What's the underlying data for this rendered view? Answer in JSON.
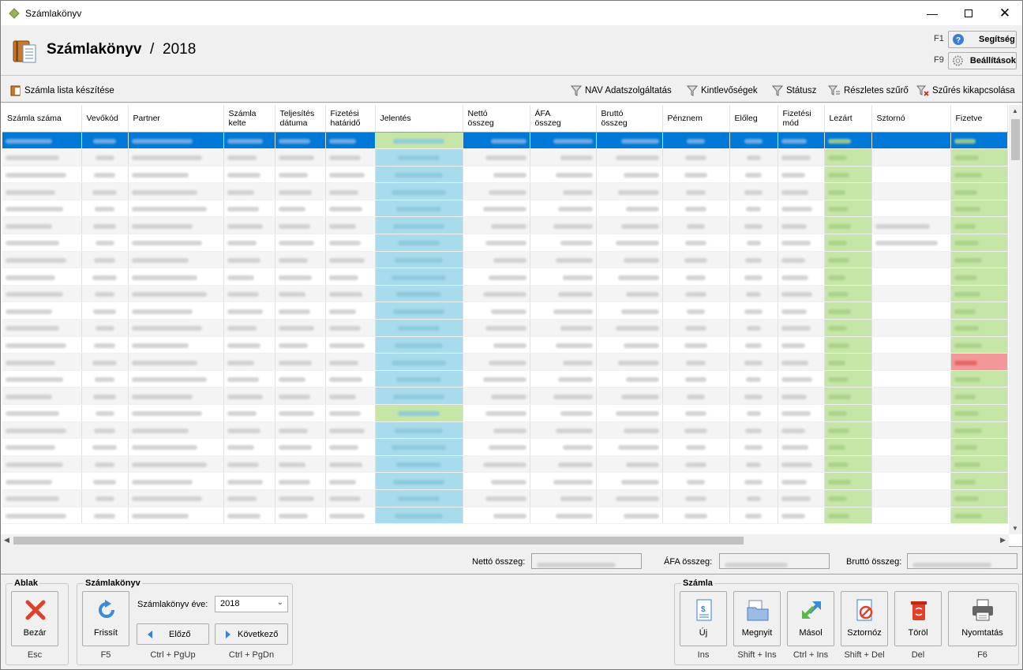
{
  "window": {
    "title": "Számlakönyv"
  },
  "header": {
    "title": "Számlakönyv",
    "separator": "/",
    "year": "2018",
    "help": {
      "key": "F1",
      "label": "Segítség"
    },
    "settings": {
      "key": "F9",
      "label": "Beállítások"
    }
  },
  "toolbar": {
    "create_list": "Számla lista készítése",
    "nav": "NAV Adatszolgáltatás",
    "receivables": "Kintlevőségek",
    "status": "Státusz",
    "detailed_filter": "Részletes szűrő",
    "filter_off": "Szűrés kikapcsolása"
  },
  "columns": [
    "Számla száma",
    "Vevőkód",
    "Partner",
    "Számla\nkelte",
    "Teljesítés\ndátuma",
    "Fizetési\nhatáridő",
    "Jelentés",
    "Nettó\nösszeg",
    "ÁFA\nösszeg",
    "Bruttó\nösszeg",
    "Pénznem",
    "Előleg",
    "Fizetési\nmód",
    "Lezárt",
    "Sztornó",
    "Fizetve"
  ],
  "rows": [
    {
      "jel": "ok",
      "fiz": "",
      "sel": true
    },
    {
      "jel": "",
      "fiz": ""
    },
    {
      "jel": "",
      "fiz": ""
    },
    {
      "jel": "",
      "fiz": ""
    },
    {
      "jel": "",
      "fiz": ""
    },
    {
      "jel": "",
      "fiz": "",
      "sz": true
    },
    {
      "jel": "",
      "fiz": "",
      "sz": true
    },
    {
      "jel": "",
      "fiz": ""
    },
    {
      "jel": "",
      "fiz": ""
    },
    {
      "jel": "",
      "fiz": ""
    },
    {
      "jel": "",
      "fiz": ""
    },
    {
      "jel": "",
      "fiz": ""
    },
    {
      "jel": "",
      "fiz": ""
    },
    {
      "jel": "",
      "fiz": "red"
    },
    {
      "jel": "",
      "fiz": ""
    },
    {
      "jel": "",
      "fiz": ""
    },
    {
      "jel": "ok",
      "fiz": ""
    },
    {
      "jel": "",
      "fiz": ""
    },
    {
      "jel": "",
      "fiz": ""
    },
    {
      "jel": "",
      "fiz": ""
    },
    {
      "jel": "",
      "fiz": ""
    },
    {
      "jel": "",
      "fiz": ""
    },
    {
      "jel": "",
      "fiz": ""
    }
  ],
  "sums": {
    "net_label": "Nettó összeg:",
    "vat_label": "ÁFA összeg:",
    "gross_label": "Bruttó összeg:"
  },
  "groups": {
    "window": {
      "title": "Ablak",
      "close": "Bezár",
      "close_key": "Esc"
    },
    "book": {
      "title": "Számlakönyv",
      "refresh": "Frissít",
      "refresh_key": "F5",
      "year_label": "Számlakönyv éve:",
      "year_value": "2018",
      "prev": "Előző",
      "prev_key": "Ctrl + PgUp",
      "next": "Következő",
      "next_key": "Ctrl + PgDn"
    },
    "invoice": {
      "title": "Számla",
      "new": "Új",
      "new_key": "Ins",
      "open": "Megnyit",
      "open_key": "Shift + Ins",
      "copy": "Másol",
      "copy_key": "Ctrl + Ins",
      "storno": "Sztornóz",
      "storno_key": "Shift + Del",
      "delete": "Töröl",
      "delete_key": "Del",
      "print": "Nyomtatás",
      "print_key": "F6"
    }
  },
  "colors": {
    "selection": "#0078d7",
    "report_blue": "#a8dbeb",
    "report_green": "#c6e6a8",
    "unpaid_red": "#f29898"
  }
}
